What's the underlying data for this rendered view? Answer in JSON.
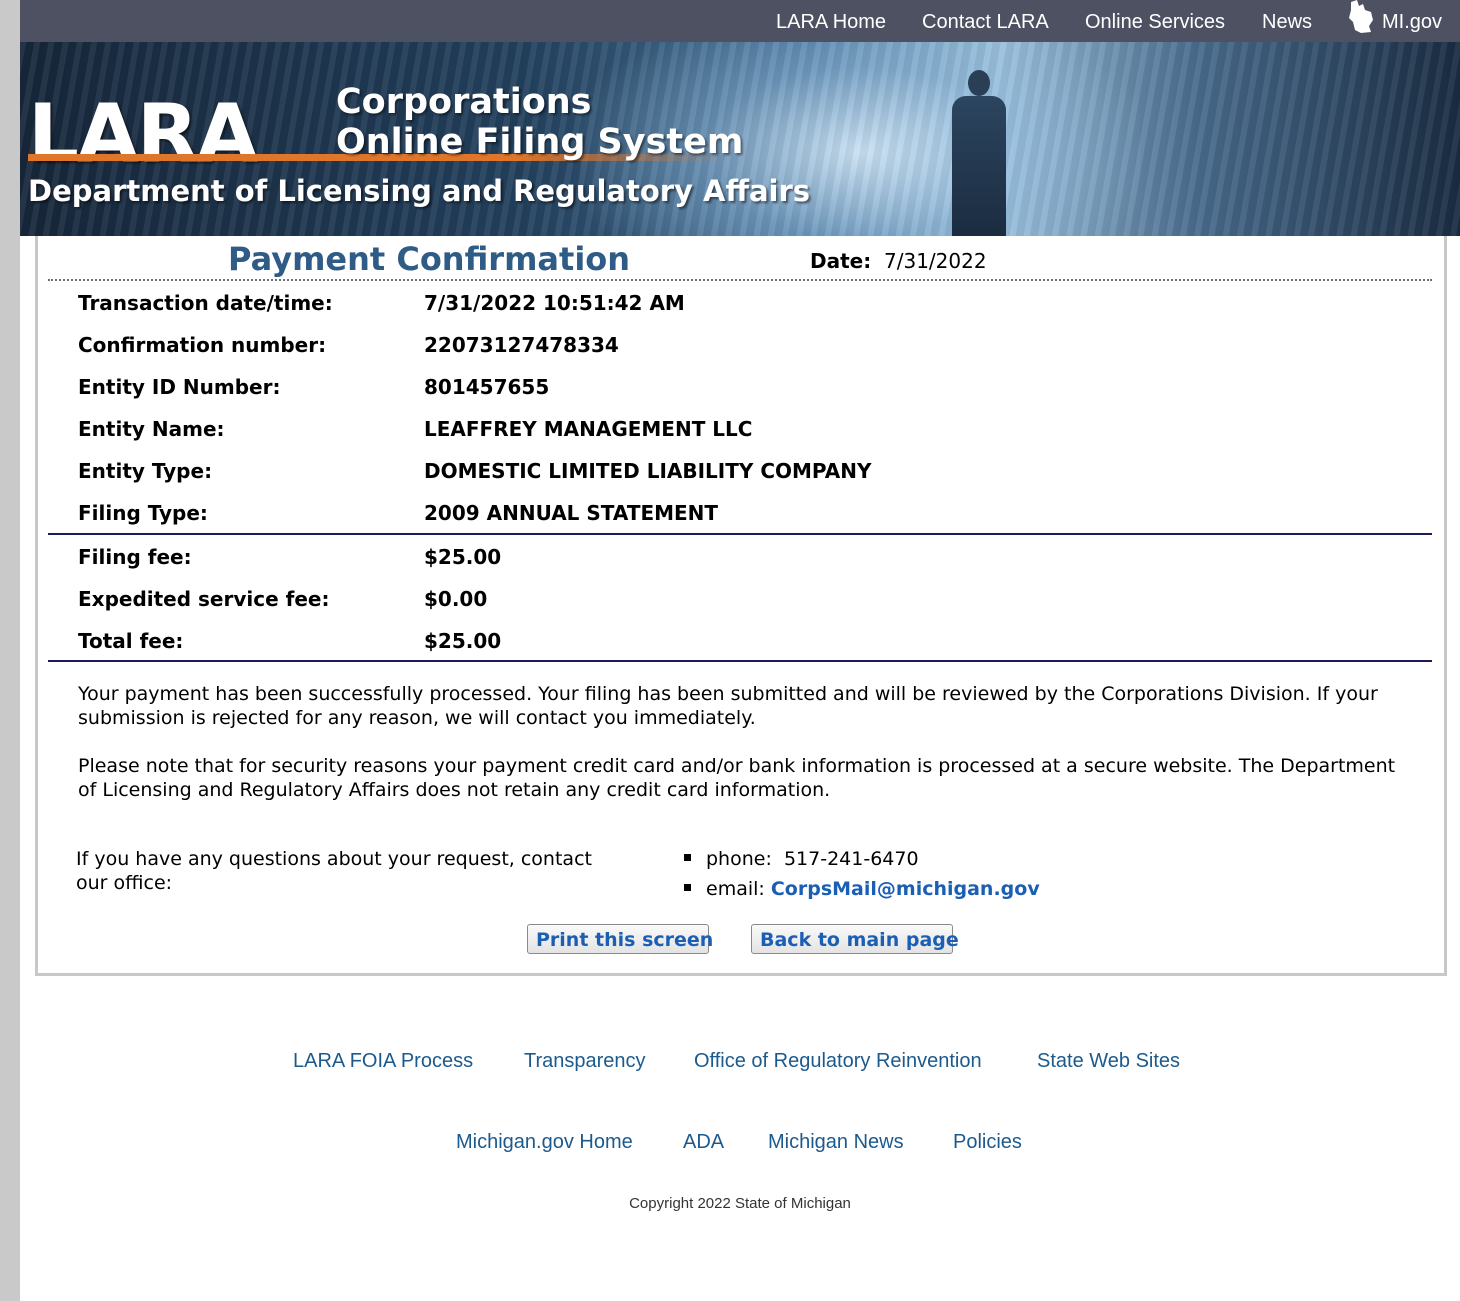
{
  "topnav": {
    "links": [
      "LARA Home",
      "Contact LARA",
      "Online Services",
      "News",
      "MI.gov"
    ]
  },
  "banner": {
    "logo": "LARA",
    "system_title_line1": "Corporations",
    "system_title_line2": "Online Filing System",
    "department": "Department of Licensing and Regulatory Affairs"
  },
  "confirmation": {
    "title": "Payment Confirmation",
    "date_label": "Date:",
    "date_value": "7/31/2022",
    "rows": [
      {
        "label": "Transaction date/time:",
        "value": "7/31/2022 10:51:42 AM"
      },
      {
        "label": "Confirmation number:",
        "value": "22073127478334"
      },
      {
        "label": "Entity ID Number:",
        "value": "801457655"
      },
      {
        "label": "Entity Name:",
        "value": "LEAFFREY MANAGEMENT LLC"
      },
      {
        "label": "Entity Type:",
        "value": "DOMESTIC LIMITED LIABILITY COMPANY"
      },
      {
        "label": "Filing Type:",
        "value": "2009 ANNUAL STATEMENT"
      }
    ],
    "fees": [
      {
        "label": "Filing fee:",
        "value": "$25.00"
      },
      {
        "label": "Expedited service fee:",
        "value": "$0.00"
      },
      {
        "label": "Total fee:",
        "value": "$25.00"
      }
    ],
    "message1": "Your payment has been successfully processed. Your filing has been submitted and will be reviewed by the Corporations Division. If your submission is rejected for any reason, we will contact you immediately.",
    "message2": "Please note that for security reasons your payment credit card and/or bank information is processed at a secure website. The Department of Licensing and Regulatory Affairs does not retain any credit card information.",
    "contact_text": "If you have any questions about your request, contact our office:",
    "phone_label": "phone:",
    "phone_value": "517-241-6470",
    "email_label": "email:",
    "email_value": "CorpsMail@michigan.gov",
    "print_button": "Print this screen",
    "back_button": "Back to main page"
  },
  "footer": {
    "row1": [
      "LARA FOIA Process",
      "Transparency",
      "Office of Regulatory Reinvention",
      "State Web Sites"
    ],
    "row2": [
      "Michigan.gov Home",
      "ADA",
      "Michigan News",
      "Policies"
    ],
    "copyright": "Copyright 2022 State of Michigan"
  }
}
